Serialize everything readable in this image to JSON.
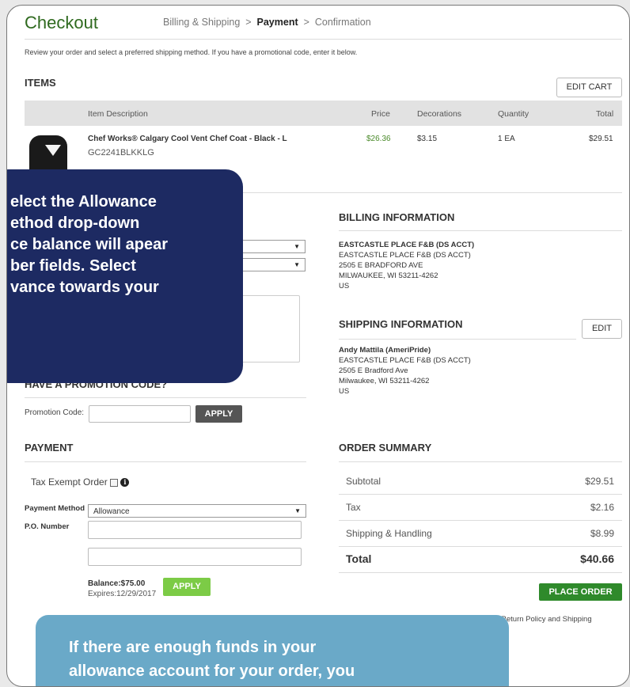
{
  "header": {
    "title": "Checkout",
    "breadcrumb": {
      "step1": "Billing & Shipping",
      "sep": ">",
      "step2": "Payment",
      "step3": "Confirmation"
    }
  },
  "intro": "Review your order and select a preferred shipping method. If you have a promotional code, enter it below.",
  "items": {
    "heading": "ITEMS",
    "edit_cart": "EDIT CART",
    "columns": [
      "Item Description",
      "Price",
      "Decorations",
      "Quantity",
      "Total"
    ],
    "rows": [
      {
        "description": "Chef Works® Calgary Cool Vent Chef Coat - Black - L",
        "sku": "GC2241BLKKLG",
        "price": "$26.36",
        "decorations": "$3.15",
        "quantity": "1 EA",
        "total": "$29.51"
      }
    ]
  },
  "billing": {
    "heading": "BILLING INFORMATION",
    "lines": [
      "EASTCASTLE PLACE F&B (DS ACCT)",
      "EASTCASTLE PLACE F&B (DS ACCT)",
      "2505 E BRADFORD AVE",
      "MILWAUKEE, WI 53211-4262",
      "US"
    ]
  },
  "shipping": {
    "heading": "SHIPPING INFORMATION",
    "edit": "EDIT",
    "lines": [
      "Andy Mattila (AmeriPride)",
      "EASTCASTLE PLACE F&B (DS ACCT)",
      "2505 E Bradford Ave",
      "Milwaukee, WI 53211-4262",
      "US"
    ]
  },
  "promo": {
    "heading": "HAVE A PROMOTION CODE?",
    "label": "Promotion Code:",
    "apply": "APPLY"
  },
  "payment": {
    "heading": "PAYMENT",
    "tax_exempt": "Tax Exempt Order",
    "method_label": "Payment Method",
    "method_value": "Allowance",
    "po_label": "P.O. Number",
    "balance": "Balance:$75.00",
    "expires": "Expires:12/29/2017",
    "apply": "APPLY"
  },
  "summary": {
    "heading": "ORDER SUMMARY",
    "subtotal_label": "Subtotal",
    "subtotal": "$29.51",
    "tax_label": "Tax",
    "tax": "$2.16",
    "shipping_label": "Shipping & Handling",
    "shipping": "$8.99",
    "total_label": "Total",
    "total": "$40.66",
    "place_order": "PLACE ORDER",
    "policy": "Return Policy and Shipping"
  },
  "callout_top": {
    "line1a": "elect the ",
    "line1b": "Allowance",
    "line2a": "ethod",
    "line2b": " drop-down",
    "line3": "ce balance will apear",
    "line4": "ber fields. Select",
    "line5": "vance towards your"
  },
  "callout_bottom": {
    "line1": "If there are enough funds in your",
    "line2": "allowance account for your order, you"
  },
  "colors": {
    "brand_green": "#2f6a1f",
    "callout_navy": "#1d2a62",
    "callout_blue": "#6aa9c8",
    "apply_green": "#7ccb46"
  }
}
